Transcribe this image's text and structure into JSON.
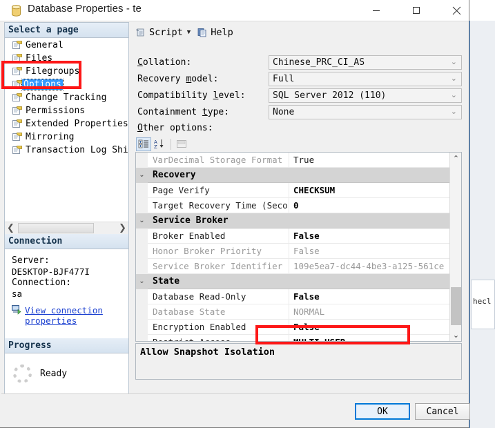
{
  "window": {
    "title": "Database Properties - te",
    "icon": "database-icon",
    "minimize": "—",
    "maximize": "☐",
    "close": "✕"
  },
  "toolbar": {
    "script_label": "Script",
    "script_caret": "▼",
    "help_label": "Help"
  },
  "sidebar": {
    "select_page_header": "Select a page",
    "pages": [
      {
        "label": "General",
        "selected": false
      },
      {
        "label": "Files",
        "selected": false
      },
      {
        "label": "Filegroups",
        "selected": false
      },
      {
        "label": "Options",
        "selected": true
      },
      {
        "label": "Change Tracking",
        "selected": false
      },
      {
        "label": "Permissions",
        "selected": false
      },
      {
        "label": "Extended Properties",
        "selected": false
      },
      {
        "label": "Mirroring",
        "selected": false
      },
      {
        "label": "Transaction Log Shi",
        "selected": false
      }
    ],
    "hscroll": {
      "left_arrow": "❮",
      "right_arrow": "❯"
    },
    "connection_header": "Connection",
    "connection": {
      "server_label": "Server:",
      "server_value": "DESKTOP-BJF477I",
      "connection_label": "Connection:",
      "connection_value": "sa",
      "view_properties_link": "View connection properties"
    },
    "progress_header": "Progress",
    "progress_status": "Ready"
  },
  "fields": [
    {
      "label_pre": "C",
      "label_key": "",
      "label": "Collation:",
      "value": "Chinese_PRC_CI_AS"
    },
    {
      "label": "Recovery model:",
      "value": "Full"
    },
    {
      "label": "Compatibility level:",
      "value": "SQL Server 2012 (110)"
    },
    {
      "label": "Containment type:",
      "value": "None"
    }
  ],
  "other_options_label": "Other options:",
  "grid_toolbar": {
    "categorized_icon": "categorized-view-icon",
    "alphabetical_icon": "alphabetical-sort-icon",
    "property_pages_icon": "property-pages-icon"
  },
  "property_grid": {
    "rows": [
      {
        "kind": "prop",
        "name": "VarDecimal Storage Format",
        "value": "True",
        "name_style": "dim",
        "value_style": "plain"
      },
      {
        "kind": "category",
        "name": "Recovery",
        "value": "",
        "expander": "⌄"
      },
      {
        "kind": "prop",
        "name": "Page Verify",
        "value": "CHECKSUM",
        "name_style": "plain",
        "value_style": "bold"
      },
      {
        "kind": "prop",
        "name": "Target Recovery Time (Seco",
        "value": "0",
        "name_style": "plain",
        "value_style": "bold"
      },
      {
        "kind": "category",
        "name": "Service Broker",
        "value": "",
        "expander": "⌄"
      },
      {
        "kind": "prop",
        "name": "Broker Enabled",
        "value": "False",
        "name_style": "plain",
        "value_style": "bold"
      },
      {
        "kind": "prop",
        "name": "Honor Broker Priority",
        "value": "False",
        "name_style": "dim",
        "value_style": "dim"
      },
      {
        "kind": "prop",
        "name": "Service Broker Identifier",
        "value": "109e5ea7-dc44-4be3-a125-561ce",
        "name_style": "dim",
        "value_style": "dim"
      },
      {
        "kind": "category",
        "name": "State",
        "value": "",
        "expander": "⌄"
      },
      {
        "kind": "prop",
        "name": "Database Read-Only",
        "value": "False",
        "name_style": "plain",
        "value_style": "bold"
      },
      {
        "kind": "prop",
        "name": "Database State",
        "value": "NORMAL",
        "name_style": "dim",
        "value_style": "dim"
      },
      {
        "kind": "prop",
        "name": "Encryption Enabled",
        "value": "False",
        "name_style": "plain",
        "value_style": "bold"
      },
      {
        "kind": "prop",
        "name": "Restrict Access",
        "value": "MULTI_USER",
        "name_style": "plain",
        "value_style": "bold"
      }
    ],
    "scroll_up_arrow": "⌃",
    "scroll_down_arrow": "⌄"
  },
  "description": {
    "title": "Allow Snapshot Isolation"
  },
  "footer": {
    "ok_label": "OK",
    "cancel_label": "Cancel"
  },
  "background": {
    "right_window_text": "hecl"
  },
  "annotations": {
    "box_color": "#fd1717",
    "highlighted_pages": "Filegroups / Options",
    "highlighted_property": "Restrict Access = MULTI_USER"
  }
}
